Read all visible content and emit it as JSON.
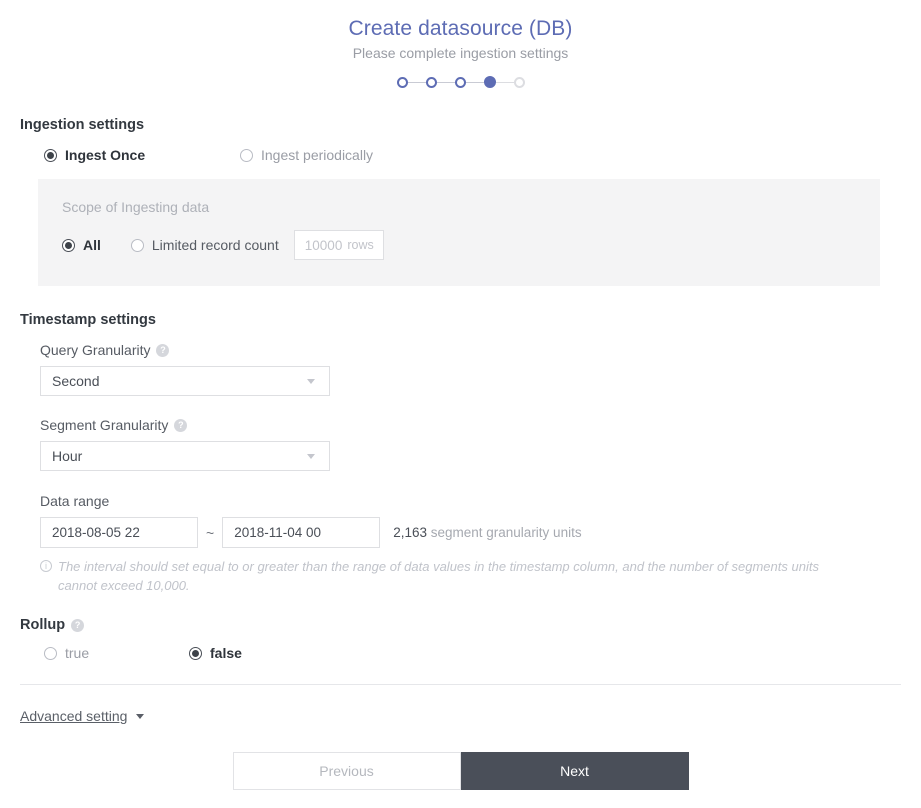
{
  "header": {
    "title": "Create datasource (DB)",
    "subtitle": "Please complete ingestion settings",
    "steps": [
      {
        "state": "done"
      },
      {
        "state": "done"
      },
      {
        "state": "done"
      },
      {
        "state": "current"
      },
      {
        "state": "upcoming"
      }
    ],
    "accent_color": "#5d6cb4",
    "inactive_color": "#dcdde1"
  },
  "ingestion": {
    "section_title": "Ingestion settings",
    "options": [
      {
        "label": "Ingest Once",
        "checked": true
      },
      {
        "label": "Ingest periodically",
        "checked": false
      }
    ],
    "scope": {
      "title": "Scope of Ingesting data",
      "options": [
        {
          "label": "All",
          "checked": true
        },
        {
          "label": "Limited record count",
          "checked": false
        }
      ],
      "record_count_placeholder": "10000",
      "record_count_unit": "rows",
      "panel_color": "#f4f4f5"
    }
  },
  "timestamp": {
    "section_title": "Timestamp settings",
    "query_granularity": {
      "label": "Query Granularity",
      "help_icon": "question-mark-icon",
      "value": "Second"
    },
    "segment_granularity": {
      "label": "Segment Granularity",
      "help_icon": "question-mark-icon",
      "value": "Hour"
    },
    "data_range": {
      "label": "Data range",
      "start": "2018-08-05 22",
      "end": "2018-11-04 00",
      "separator": "~",
      "units_count": "2,163",
      "units_label": "segment granularity units"
    },
    "warning": {
      "icon": "info-icon",
      "text": "The interval should set equal to or greater than the range of data values in the timestamp column, and the number of segments units cannot exceed 10,000."
    }
  },
  "rollup": {
    "section_title": "Rollup",
    "help_icon": "question-mark-icon",
    "options": [
      {
        "label": "true",
        "checked": false
      },
      {
        "label": "false",
        "checked": true
      }
    ]
  },
  "advanced": {
    "label": "Advanced setting",
    "caret_icon": "chevron-down-icon"
  },
  "footer": {
    "previous_label": "Previous",
    "next_label": "Next",
    "next_bg": "#4a4f59"
  }
}
